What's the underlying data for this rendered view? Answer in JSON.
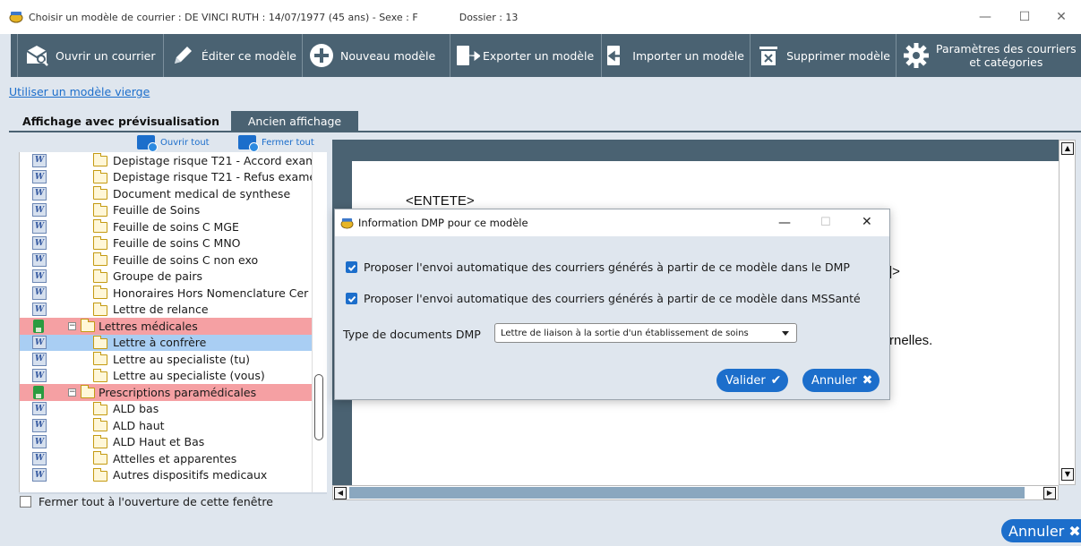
{
  "window": {
    "title": "Choisir un modèle de courrier : DE VINCI RUTH : 14/07/1977 (45 ans) - Sexe : F",
    "dossier": "Dossier : 13",
    "minimize": "—",
    "maximize": "☐",
    "close": "✕"
  },
  "toolbar": {
    "open_letter": "Ouvrir un courrier",
    "edit_model": "Éditer ce modèle",
    "new_model": "Nouveau modèle",
    "export_model": "Exporter un modèle",
    "import_model": "Importer un modèle",
    "delete_model": "Supprimer modèle",
    "params_line1": "Paramètres des courriers",
    "params_line2": "et catégories"
  },
  "links": {
    "blank_model": "Utiliser un modèle vierge"
  },
  "tabs": {
    "preview": "Affichage avec prévisualisation",
    "old": "Ancien affichage"
  },
  "tree_header": {
    "open_all": "Ouvrir tout",
    "close_all": "Fermer tout"
  },
  "tree": [
    {
      "label": "Depistage risque T21 - Accord exam",
      "kind": "doc",
      "level": 2,
      "state": ""
    },
    {
      "label": "Depistage risque T21 - Refus examen",
      "kind": "doc",
      "level": 2,
      "state": ""
    },
    {
      "label": "Document medical de synthese",
      "kind": "doc",
      "level": 2,
      "state": ""
    },
    {
      "label": "Feuille de Soins",
      "kind": "doc",
      "level": 2,
      "state": ""
    },
    {
      "label": "Feuille de soins C MGE",
      "kind": "doc",
      "level": 2,
      "state": ""
    },
    {
      "label": "Feuille de soins C MNO",
      "kind": "doc",
      "level": 2,
      "state": ""
    },
    {
      "label": "Feuille de soins C non exo",
      "kind": "doc",
      "level": 2,
      "state": ""
    },
    {
      "label": "Groupe de pairs",
      "kind": "doc",
      "level": 2,
      "state": ""
    },
    {
      "label": "Honoraires Hors Nomenclature Cer",
      "kind": "doc",
      "level": 2,
      "state": ""
    },
    {
      "label": "Lettre de relance",
      "kind": "doc",
      "level": 2,
      "state": ""
    },
    {
      "label": "Lettres médicales",
      "kind": "folder",
      "level": 1,
      "state": "red"
    },
    {
      "label": "Lettre à confrère",
      "kind": "doc",
      "level": 2,
      "state": "sel"
    },
    {
      "label": "Lettre au specialiste (tu)",
      "kind": "doc",
      "level": 2,
      "state": ""
    },
    {
      "label": "Lettre au specialiste (vous)",
      "kind": "doc",
      "level": 2,
      "state": ""
    },
    {
      "label": "Prescriptions paramédicales",
      "kind": "folder",
      "level": 1,
      "state": "red"
    },
    {
      "label": "ALD bas",
      "kind": "doc",
      "level": 2,
      "state": ""
    },
    {
      "label": "ALD haut",
      "kind": "doc",
      "level": 2,
      "state": ""
    },
    {
      "label": "ALD Haut et Bas",
      "kind": "doc",
      "level": 2,
      "state": ""
    },
    {
      "label": "Attelles et apparentes",
      "kind": "doc",
      "level": 2,
      "state": ""
    },
    {
      "label": "Autres dispositifs medicaux",
      "kind": "doc",
      "level": 2,
      "state": ""
    }
  ],
  "close_all_on_open": "Fermer tout à l'ouverture de cette fenêtre",
  "preview": {
    "entete": "<ENTETE>",
    "fragment1": "]>",
    "fragment2": "rnelles."
  },
  "cancel_main": "Annuler",
  "dialog": {
    "title": "Information DMP pour ce modèle",
    "check_dmp": "Proposer l'envoi automatique des courriers générés à partir de ce  modèle dans le DMP",
    "check_mss": "Proposer l'envoi automatique des courriers générés à partir de ce  modèle dans MSSanté",
    "type_label": "Type de documents DMP",
    "type_value": "Lettre de liaison à la sortie d'un établissement de soins",
    "validate": "Valider",
    "cancel": "Annuler"
  }
}
